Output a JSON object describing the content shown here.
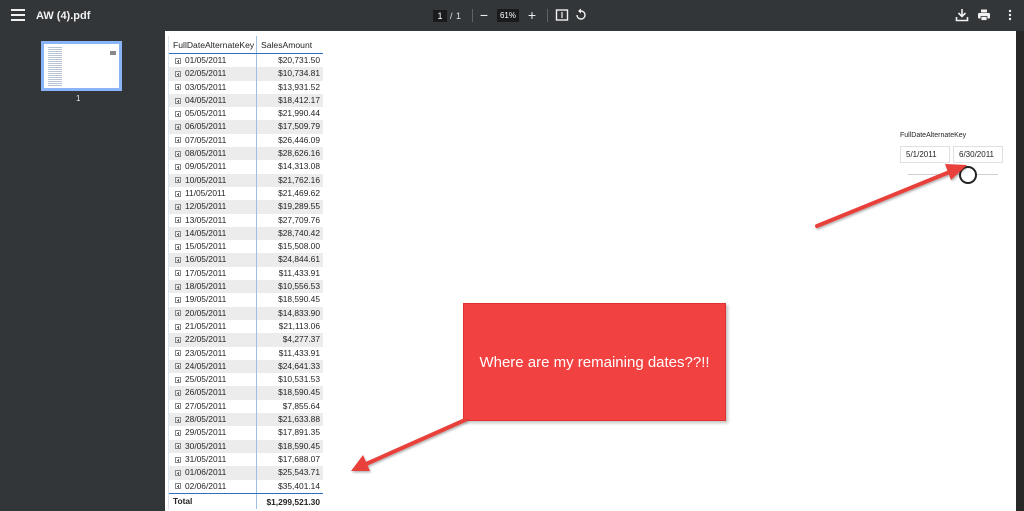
{
  "toolbar": {
    "title": "AW (4).pdf",
    "page_current": "1",
    "page_separator": "/",
    "page_total": "1",
    "zoom": "61%",
    "zoom_out_icon": "−",
    "zoom_in_icon": "+"
  },
  "sidebar": {
    "thumbnail_number": "1"
  },
  "matrix": {
    "headers": [
      "FullDateAlternateKey",
      "SalesAmount"
    ],
    "rows": [
      [
        "01/05/2011",
        "$20,731.50"
      ],
      [
        "02/05/2011",
        "$10,734.81"
      ],
      [
        "03/05/2011",
        "$13,931.52"
      ],
      [
        "04/05/2011",
        "$18,412.17"
      ],
      [
        "05/05/2011",
        "$21,990.44"
      ],
      [
        "06/05/2011",
        "$17,509.79"
      ],
      [
        "07/05/2011",
        "$26,446.09"
      ],
      [
        "08/05/2011",
        "$28,626.16"
      ],
      [
        "09/05/2011",
        "$14,313.08"
      ],
      [
        "10/05/2011",
        "$21,762.16"
      ],
      [
        "11/05/2011",
        "$21,469.62"
      ],
      [
        "12/05/2011",
        "$19,289.55"
      ],
      [
        "13/05/2011",
        "$27,709.76"
      ],
      [
        "14/05/2011",
        "$28,740.42"
      ],
      [
        "15/05/2011",
        "$15,508.00"
      ],
      [
        "16/05/2011",
        "$24,844.61"
      ],
      [
        "17/05/2011",
        "$11,433.91"
      ],
      [
        "18/05/2011",
        "$10,556.53"
      ],
      [
        "19/05/2011",
        "$18,590.45"
      ],
      [
        "20/05/2011",
        "$14,833.90"
      ],
      [
        "21/05/2011",
        "$21,113.06"
      ],
      [
        "22/05/2011",
        "$4,277.37"
      ],
      [
        "23/05/2011",
        "$11,433.91"
      ],
      [
        "24/05/2011",
        "$24,641.33"
      ],
      [
        "25/05/2011",
        "$10,531.53"
      ],
      [
        "26/05/2011",
        "$18,590.45"
      ],
      [
        "27/05/2011",
        "$7,855.64"
      ],
      [
        "28/05/2011",
        "$21,633.88"
      ],
      [
        "29/05/2011",
        "$17,891.35"
      ],
      [
        "30/05/2011",
        "$18,590.45"
      ],
      [
        "31/05/2011",
        "$17,688.07"
      ],
      [
        "01/06/2011",
        "$25,543.71"
      ],
      [
        "02/06/2011",
        "$35,401.14"
      ]
    ],
    "total_label": "Total",
    "total_value": "$1,299,521.30"
  },
  "slicer": {
    "title": "FullDateAlternateKey",
    "start": "5/1/2011",
    "end": "6/30/2011"
  },
  "callout": {
    "text": "Where are my remaining dates??!!"
  },
  "colors": {
    "callout_fill": "#f14140",
    "arrow": "#e8403a",
    "toolbar_bg": "#323639"
  }
}
